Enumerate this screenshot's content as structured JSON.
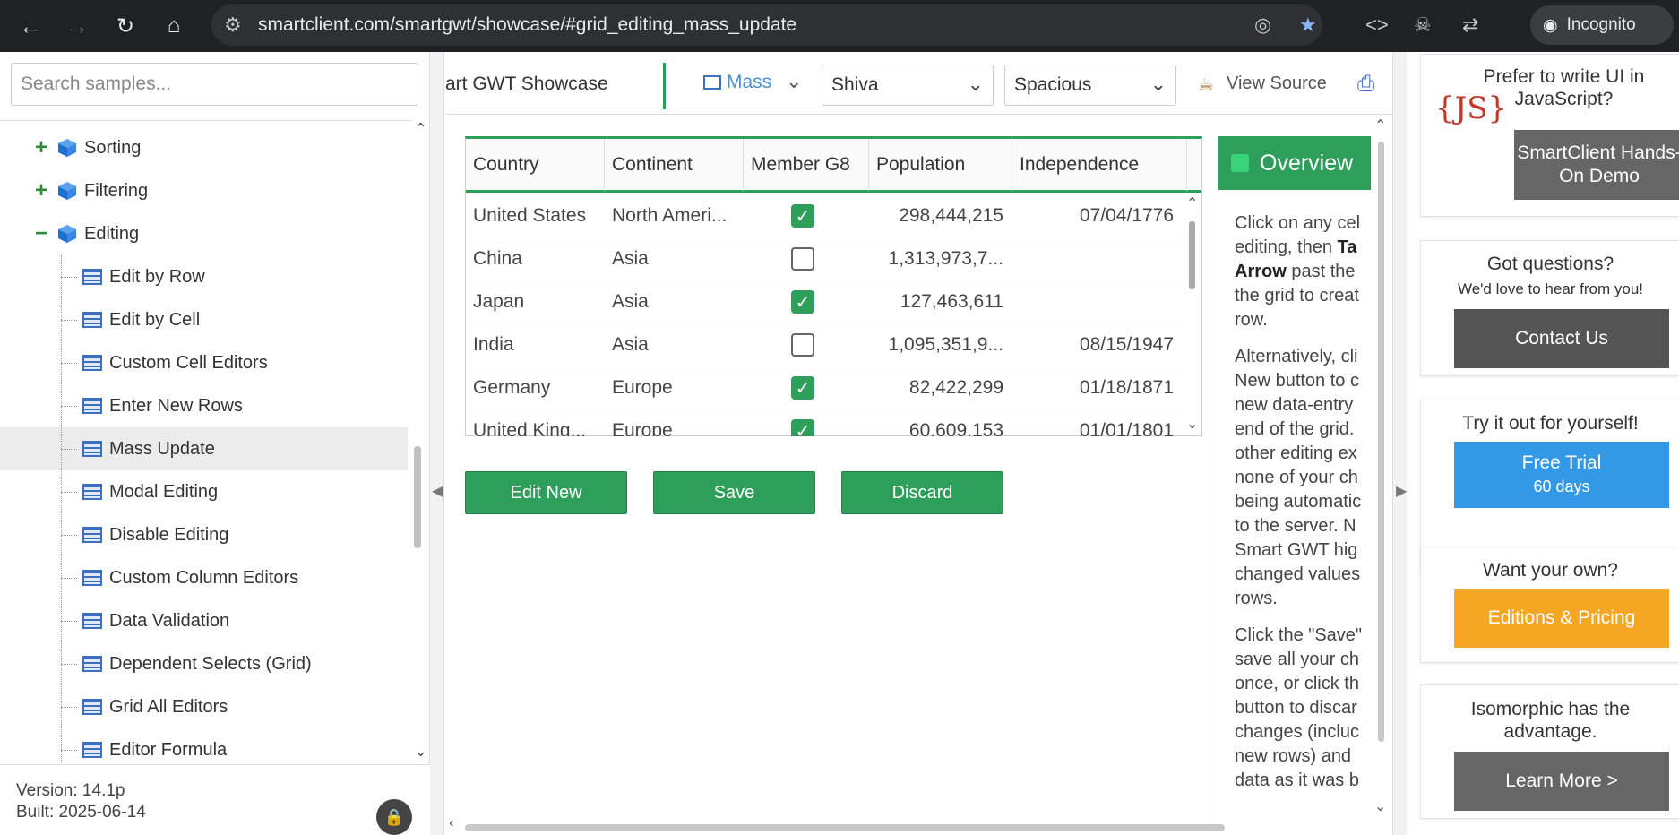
{
  "browser": {
    "url": "smartclient.com/smartgwt/showcase/#grid_editing_mass_update",
    "incognito_label": "Incognito"
  },
  "left_panel": {
    "search_placeholder": "Search samples...",
    "tree": [
      {
        "label": "Sorting",
        "type": "folder",
        "expander": "+"
      },
      {
        "label": "Filtering",
        "type": "folder",
        "expander": "+"
      },
      {
        "label": "Editing",
        "type": "folder",
        "expander": "−"
      },
      {
        "label": "Edit by Row",
        "type": "sample"
      },
      {
        "label": "Edit by Cell",
        "type": "sample"
      },
      {
        "label": "Custom Cell Editors",
        "type": "sample"
      },
      {
        "label": "Enter New Rows",
        "type": "sample"
      },
      {
        "label": "Mass Update",
        "type": "sample",
        "selected": true
      },
      {
        "label": "Modal Editing",
        "type": "sample"
      },
      {
        "label": "Disable Editing",
        "type": "sample"
      },
      {
        "label": "Custom Column Editors",
        "type": "sample"
      },
      {
        "label": "Data Validation",
        "type": "sample"
      },
      {
        "label": "Dependent Selects (Grid)",
        "type": "sample"
      },
      {
        "label": "Grid All Editors",
        "type": "sample"
      },
      {
        "label": "Editor Formula",
        "type": "sample"
      }
    ],
    "version": "Version: 14.1p",
    "built": "Built: 2025-06-14"
  },
  "toolbar": {
    "showcase_title": "art GWT Showcase",
    "current_sample": "Mass",
    "skin_select": "Shiva",
    "density_select": "Spacious",
    "view_source": "View Source"
  },
  "grid": {
    "columns": [
      "Country",
      "Continent",
      "Member G8",
      "Population",
      "Independence"
    ],
    "rows": [
      {
        "country": "United States",
        "continent": "North Ameri...",
        "g8": true,
        "population": "298,444,215",
        "independence": "07/04/1776"
      },
      {
        "country": "China",
        "continent": "Asia",
        "g8": false,
        "population": "1,313,973,7...",
        "independence": ""
      },
      {
        "country": "Japan",
        "continent": "Asia",
        "g8": true,
        "population": "127,463,611",
        "independence": ""
      },
      {
        "country": "India",
        "continent": "Asia",
        "g8": false,
        "population": "1,095,351,9...",
        "independence": "08/15/1947"
      },
      {
        "country": "Germany",
        "continent": "Europe",
        "g8": true,
        "population": "82,422,299",
        "independence": "01/18/1871"
      },
      {
        "country": "United King...",
        "continent": "Europe",
        "g8": true,
        "population": "60,609,153",
        "independence": "01/01/1801"
      }
    ]
  },
  "buttons": {
    "edit_new": "Edit New",
    "save": "Save",
    "discard": "Discard"
  },
  "overview": {
    "title": "Overview",
    "lines_p1": [
      "Click on any cel",
      "editing, then Ta",
      "Arrow past the",
      "the grid to creat",
      "row."
    ],
    "lines_p2": [
      "Alternatively, cli",
      "New button to c",
      "new data-entry",
      "end of the grid.",
      "other editing ex",
      "none of your ch",
      "being automatic",
      "to the server. N",
      "Smart GWT hig",
      "changed values",
      "rows."
    ],
    "lines_p3": [
      "Click the \"Save\"",
      "save all your ch",
      "once, or click th",
      "button to discar",
      "changes (incluc",
      "new rows) and",
      "data as it was b"
    ]
  },
  "right_panel": {
    "js_title": "Prefer to write UI in JavaScript?",
    "js_logo_text": "{JS}",
    "js_button": "SmartClient Hands-On Demo",
    "questions_title": "Got questions?",
    "questions_sub": "We'd love to hear from you!",
    "contact_button": "Contact Us",
    "trial_title": "Try it out for yourself!",
    "trial_button_line1": "Free Trial",
    "trial_button_line2": "60 days",
    "own_title": "Want your own?",
    "pricing_button": "Editions & Pricing",
    "iso_title": "Isomorphic has the advantage.",
    "learn_button": "Learn More >"
  },
  "colors": {
    "accent_green": "#2e9e5b",
    "trial_blue": "#3399e6",
    "pricing_orange": "#f5a623",
    "dark_button": "#555555"
  }
}
